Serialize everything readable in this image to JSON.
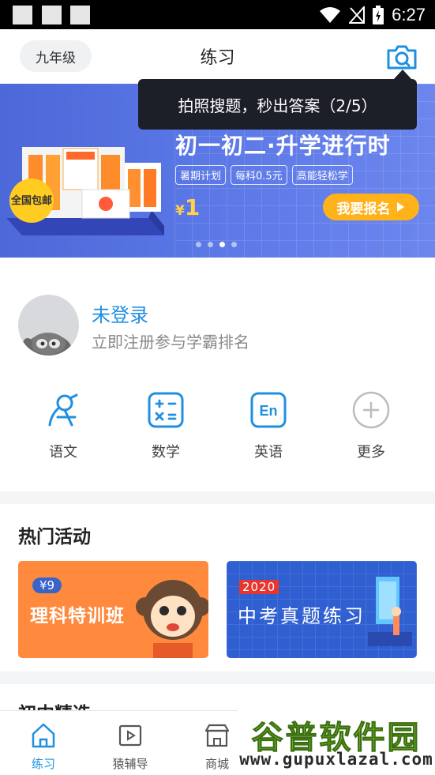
{
  "status_bar": {
    "time": "6:27"
  },
  "header": {
    "grade": "九年级",
    "title": "练习",
    "camera_icon": "camera-icon"
  },
  "tooltip": {
    "text": "拍照搜题，秒出答案（2/5）"
  },
  "banner": {
    "headline": "初一初二·升学进行时",
    "tags": [
      "暑期计划",
      "每科0.5元",
      "高能轻松学"
    ],
    "price_symbol": "¥",
    "price": "1",
    "cta": "我要报名",
    "badge": "全国包邮",
    "dots": {
      "count": 4,
      "active_index": 2
    }
  },
  "profile": {
    "title": "未登录",
    "subtitle": "立即注册参与学霸排名"
  },
  "subjects": [
    {
      "label": "语文",
      "icon": "chinese-icon"
    },
    {
      "label": "数学",
      "icon": "math-icon"
    },
    {
      "label": "英语",
      "icon": "english-icon"
    },
    {
      "label": "更多",
      "icon": "plus-icon"
    }
  ],
  "activities": {
    "title": "热门活动",
    "cards": [
      {
        "tag": "¥9",
        "title": "理科特训班"
      },
      {
        "tag": "2020",
        "title": "中考真题练习"
      }
    ]
  },
  "selected": {
    "title": "初中精选"
  },
  "bottom_nav": [
    {
      "label": "练习",
      "icon": "home-icon",
      "active": true
    },
    {
      "label": "猿辅导",
      "icon": "play-icon",
      "active": false
    },
    {
      "label": "商城",
      "icon": "store-icon",
      "active": false
    }
  ],
  "watermark": {
    "cn": "谷普软件园",
    "en": "www.gupuxlazal.com"
  },
  "colors": {
    "accent": "#1f8fe0",
    "banner": "#5a77e6",
    "cta": "#ffb21a",
    "orange_card": "#ff8a3d",
    "blue_card": "#2f5fd0"
  }
}
